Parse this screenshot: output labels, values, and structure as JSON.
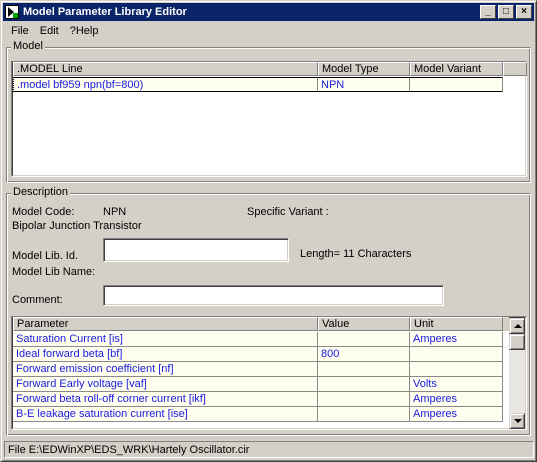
{
  "window": {
    "title": "Model Parameter Library Editor",
    "buttons": {
      "minimize": "_",
      "maximize": "□",
      "close": "×"
    }
  },
  "menu": [
    "File",
    "Edit",
    "?Help"
  ],
  "model_group": {
    "label": "Model",
    "columns": [
      ".MODEL Line",
      "Model Type",
      "Model Variant"
    ],
    "rows": [
      {
        "model_line": ".model bf959 npn(bf=800)",
        "model_type": "NPN",
        "model_variant": ""
      }
    ]
  },
  "description": {
    "label": "Description",
    "model_code_label": "Model Code:",
    "model_code_value": "NPN",
    "specific_variant_label": "Specific Variant :",
    "specific_variant_value": "",
    "type_description": "Bipolar Junction Transistor",
    "model_lib_id_label": "Model Lib. Id.",
    "model_lib_id_value": "",
    "length_text": "Length= 11 Characters",
    "model_lib_name_label": "Model Lib Name:",
    "model_lib_name_value": "",
    "comment_label": "Comment:",
    "comment_value": ""
  },
  "params": {
    "columns": [
      "Parameter",
      "Value",
      "Unit"
    ],
    "rows": [
      {
        "parameter": "Saturation Current [is]",
        "value": "",
        "unit": "Amperes"
      },
      {
        "parameter": "Ideal forward beta [bf]",
        "value": "800",
        "unit": ""
      },
      {
        "parameter": "Forward emission coefficient [nf]",
        "value": "",
        "unit": ""
      },
      {
        "parameter": "Forward Early voltage [vaf]",
        "value": "",
        "unit": "Volts"
      },
      {
        "parameter": "Forward beta roll-off corner current [ikf]",
        "value": "",
        "unit": "Amperes"
      },
      {
        "parameter": "B-E leakage saturation current [ise]",
        "value": "",
        "unit": "Amperes"
      }
    ]
  },
  "status": {
    "text": "File E:\\EDWinXP\\EDS_WRK\\Hartely Oscillator.cir"
  },
  "colors": {
    "title_bg": "#0a246a",
    "cell_text": "#1a1ae0",
    "cell_bg": "#fffff0",
    "face": "#d4d0c8"
  }
}
